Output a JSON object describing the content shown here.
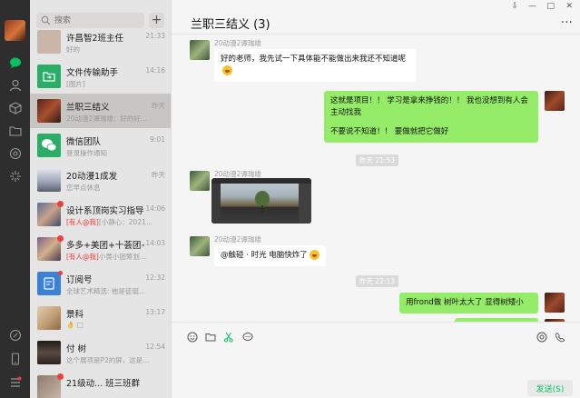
{
  "window": {
    "pin_label": "⇩",
    "minimize_label": "—",
    "maximize_label": "□",
    "close_label": "✕"
  },
  "search": {
    "placeholder": "搜索",
    "value": ""
  },
  "new_chat_label": "+",
  "sessions": [
    {
      "name": "许昌智2班主任",
      "time": "21:33",
      "preview": "好的",
      "mention": "",
      "avatar_color": "#c9b6a8",
      "unread": false
    },
    {
      "name": "文件传输助手",
      "time": "14:16",
      "preview": "[图片]",
      "mention": "",
      "avatar_color": "#2aae67",
      "unread": false
    },
    {
      "name": "兰职三结义",
      "time": "昨天",
      "preview": "20动漫2谭瑞雄：好的好...",
      "mention": "",
      "avatar_color": "#6b3a2a",
      "unread": false
    },
    {
      "name": "微信团队",
      "time": "9:01",
      "preview": "登录操作通知",
      "mention": "",
      "avatar_color": "#2aae67",
      "unread": false
    },
    {
      "name": "20动漫1成发",
      "time": "昨天",
      "preview": "您早点休息",
      "mention": "",
      "avatar_color": "#9aa3b5",
      "unread": false
    },
    {
      "name": "设计系顶岗实习指导...",
      "time": "14:06",
      "preview": "[小静心：2021...",
      "mention": "[有人@我]",
      "avatar_color": "#5a6e9c",
      "unread": true
    },
    {
      "name": "多多+美团+十荟团+...",
      "time": "14:03",
      "preview": "小黄小团筹划...",
      "mention": "[有人@我]",
      "avatar_color": "#7d5f8a",
      "unread": true
    },
    {
      "name": "订阅号",
      "time": "12:32",
      "preview": "全球艺术精选: 他是徒诞...",
      "mention": "",
      "avatar_color": "#3b82d6",
      "unread": false
    },
    {
      "name": "景科",
      "time": "13:17",
      "preview": "👌 □",
      "mention": "",
      "avatar_color": "#c4a27a",
      "unread": false
    },
    {
      "name": "付 树",
      "time": "12:54",
      "preview": "这个展项是P2的屏，这是...",
      "mention": "",
      "avatar_color": "#3a3230",
      "unread": false
    },
    {
      "name": "21级动... 班三班群",
      "time": "",
      "preview": "",
      "mention": "",
      "avatar_color": "#8c7a6e",
      "unread": true
    }
  ],
  "chat": {
    "title": "兰职三结义 (3)",
    "more_label": "···",
    "messages": [
      {
        "sender": "20动漫2谭瑞雄",
        "text": "好的老师，我先试一下具体能不能做出来我还不知道呢",
        "side": "in"
      },
      {
        "sender": "",
        "text_1": "这就是项目！！ 学习是拿来挣钱的！！ 我也没想到有人会主动找我",
        "text_2": "不要说不知道！！ 要做就把它做好",
        "side": "out"
      },
      {
        "time_stamp": "昨天 21:53"
      },
      {
        "sender": "20动漫2谭瑞雄",
        "type": "image",
        "side": "in"
      },
      {
        "sender": "20动漫2谭瑞雄",
        "text": "@触碰 · 时光 电脑快炸了",
        "side": "in"
      },
      {
        "time_stamp": "昨天 22:13"
      },
      {
        "sender": "",
        "text": "用frond做  树叶太大了   显得树矮小",
        "side": "out"
      }
    ]
  },
  "toolbar_icons": [
    "emoji-icon",
    "folder-icon",
    "scissors-icon",
    "chat-history-icon",
    "voice-call-icon",
    "video-call-icon"
  ],
  "send_label": "发送(S)",
  "colors": {
    "accent": "#07c160",
    "bubble_out": "#95ec69",
    "rail": "#2e2e2e",
    "unread_dot": "#f23b3b"
  }
}
